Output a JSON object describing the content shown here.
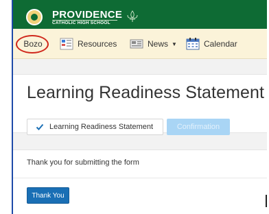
{
  "brand": {
    "name": "PROVIDENCE",
    "subtitle": "CATHOLIC HIGH SCHOOL"
  },
  "nav": {
    "items": [
      {
        "label": "Bozo",
        "icon": "none",
        "highlighted": true
      },
      {
        "label": "Resources",
        "icon": "grid-document-icon"
      },
      {
        "label": "News",
        "icon": "newspaper-icon",
        "dropdown": true
      },
      {
        "label": "Calendar",
        "icon": "calendar-icon"
      }
    ]
  },
  "page": {
    "title": "Learning Readiness Statement",
    "steps": [
      {
        "label": "Learning Readiness Statement",
        "state": "completed"
      },
      {
        "label": "Confirmation",
        "state": "inactive"
      }
    ],
    "message": "Thank you for submitting the form",
    "button_label": "Thank You"
  },
  "colors": {
    "brand_green": "#0e6b34",
    "nav_bg": "#fbf3d9",
    "highlight_circle": "#d0281c",
    "primary_button": "#1a6fb5",
    "inactive_step": "#a9d5f5"
  }
}
